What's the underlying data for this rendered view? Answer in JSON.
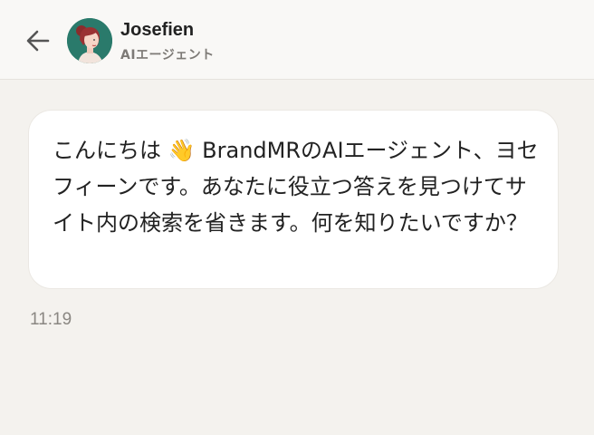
{
  "header": {
    "back_icon": "arrow-left-icon",
    "agent_name": "Josefien",
    "agent_role": "AIエージェント",
    "avatar_bg": "#2a7a6b"
  },
  "message": {
    "text_before_emoji": "こんにちは",
    "emoji": "👋",
    "text_after_emoji": "BrandMRのAIエージェント、ヨセフィーンです。あなたに役立つ答えを見つけてサイト内の検索を省きます。何を知りたいですか？",
    "time": "11:19"
  }
}
